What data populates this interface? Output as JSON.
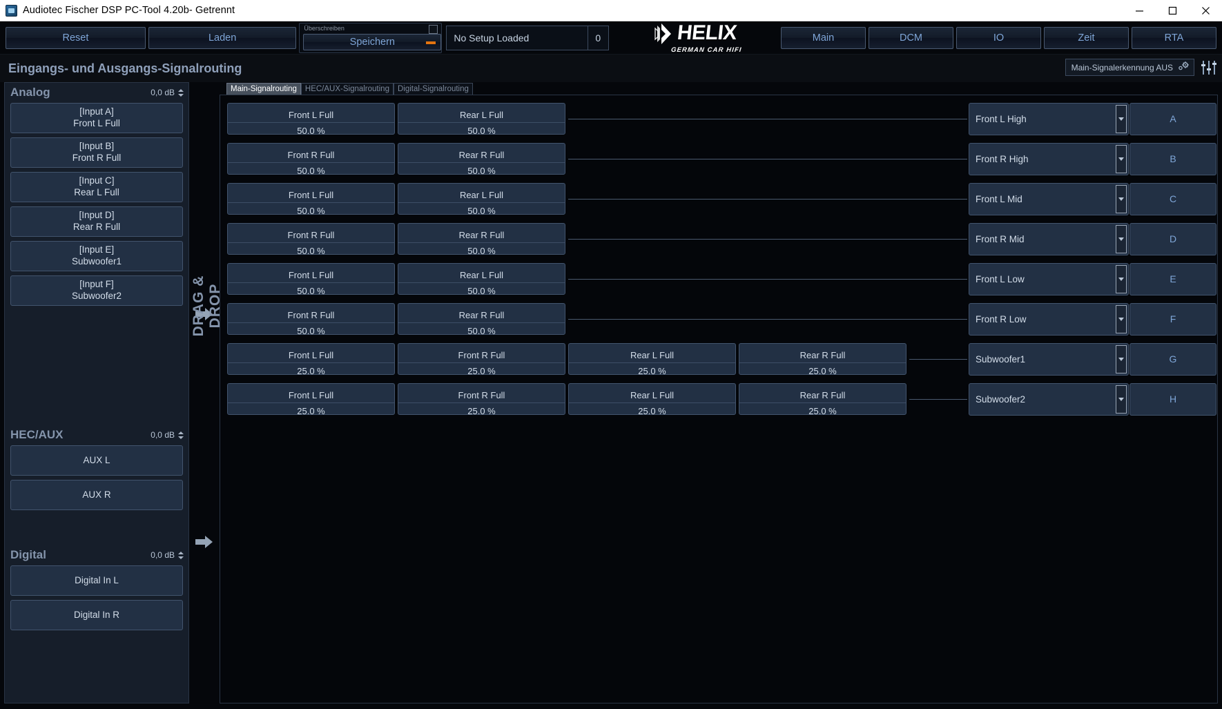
{
  "window": {
    "title": "Audiotec Fischer DSP PC-Tool 4.20b- Getrennt",
    "minimize": "minimize-icon",
    "maximize": "maximize-icon",
    "close": "close-icon"
  },
  "toolbar": {
    "reset": "Reset",
    "laden": "Laden",
    "overwrite_label": "Überschreiben",
    "speichern": "Speichern",
    "setup_name": "No Setup Loaded",
    "setup_number": "0",
    "logo_word": "HELIX",
    "logo_sub": "GERMAN CAR HIFI",
    "nav": [
      "Main",
      "DCM",
      "IO",
      "Zeit",
      "RTA"
    ]
  },
  "page": {
    "title": "Eingangs- und Ausgangs-Signalrouting",
    "signal_detection": "Main-Signalerkennung AUS",
    "gear_icon": "gear-icon",
    "eq_icon": "equalizer-icon"
  },
  "sidebar": {
    "drag_drop_label": "DRAG & DROP",
    "sections": [
      {
        "title": "Analog",
        "db": "0,0 dB",
        "items": [
          {
            "tag": "[Input A]",
            "name": "Front L Full"
          },
          {
            "tag": "[Input B]",
            "name": "Front R Full"
          },
          {
            "tag": "[Input C]",
            "name": "Rear L Full"
          },
          {
            "tag": "[Input D]",
            "name": "Rear R Full"
          },
          {
            "tag": "[Input E]",
            "name": "Subwoofer1"
          },
          {
            "tag": "[Input F]",
            "name": "Subwoofer2"
          }
        ]
      },
      {
        "title": "HEC/AUX",
        "db": "0,0 dB",
        "items": [
          {
            "tag": "",
            "name": "AUX L"
          },
          {
            "tag": "",
            "name": "AUX R"
          }
        ]
      },
      {
        "title": "Digital",
        "db": "0,0 dB",
        "items": [
          {
            "tag": "",
            "name": "Digital In L"
          },
          {
            "tag": "",
            "name": "Digital In R"
          }
        ]
      }
    ]
  },
  "routing": {
    "tabs": [
      {
        "label": "Main-Signalrouting",
        "active": true
      },
      {
        "label": "HEC/AUX-Signalrouting",
        "active": false
      },
      {
        "label": "Digital-Signalrouting",
        "active": false
      }
    ],
    "rows": [
      {
        "cells": [
          {
            "name": "Front L Full",
            "value": "50.0 %"
          },
          {
            "name": "Rear L Full",
            "value": "50.0 %"
          }
        ],
        "output": {
          "name": "Front L High",
          "letter": "A"
        }
      },
      {
        "cells": [
          {
            "name": "Front R Full",
            "value": "50.0 %"
          },
          {
            "name": "Rear R Full",
            "value": "50.0 %"
          }
        ],
        "output": {
          "name": "Front R High",
          "letter": "B"
        }
      },
      {
        "cells": [
          {
            "name": "Front L Full",
            "value": "50.0 %"
          },
          {
            "name": "Rear L Full",
            "value": "50.0 %"
          }
        ],
        "output": {
          "name": "Front L Mid",
          "letter": "C"
        }
      },
      {
        "cells": [
          {
            "name": "Front R Full",
            "value": "50.0 %"
          },
          {
            "name": "Rear R Full",
            "value": "50.0 %"
          }
        ],
        "output": {
          "name": "Front R Mid",
          "letter": "D"
        }
      },
      {
        "cells": [
          {
            "name": "Front L Full",
            "value": "50.0 %"
          },
          {
            "name": "Rear L Full",
            "value": "50.0 %"
          }
        ],
        "output": {
          "name": "Front L Low",
          "letter": "E"
        }
      },
      {
        "cells": [
          {
            "name": "Front R Full",
            "value": "50.0 %"
          },
          {
            "name": "Rear R Full",
            "value": "50.0 %"
          }
        ],
        "output": {
          "name": "Front R Low",
          "letter": "F"
        }
      },
      {
        "cells": [
          {
            "name": "Front L Full",
            "value": "25.0 %"
          },
          {
            "name": "Front R Full",
            "value": "25.0 %"
          },
          {
            "name": "Rear L Full",
            "value": "25.0 %"
          },
          {
            "name": "Rear R Full",
            "value": "25.0 %"
          }
        ],
        "output": {
          "name": "Subwoofer1",
          "letter": "G"
        }
      },
      {
        "cells": [
          {
            "name": "Front L Full",
            "value": "25.0 %"
          },
          {
            "name": "Front R Full",
            "value": "25.0 %"
          },
          {
            "name": "Rear L Full",
            "value": "25.0 %"
          },
          {
            "name": "Rear R Full",
            "value": "25.0 %"
          }
        ],
        "output": {
          "name": "Subwoofer2",
          "letter": "H"
        }
      }
    ]
  },
  "colors": {
    "accent": "#7fa6d8",
    "panel": "#223044",
    "border": "#42546d",
    "orange": "#e37410",
    "background": "#05070b"
  }
}
